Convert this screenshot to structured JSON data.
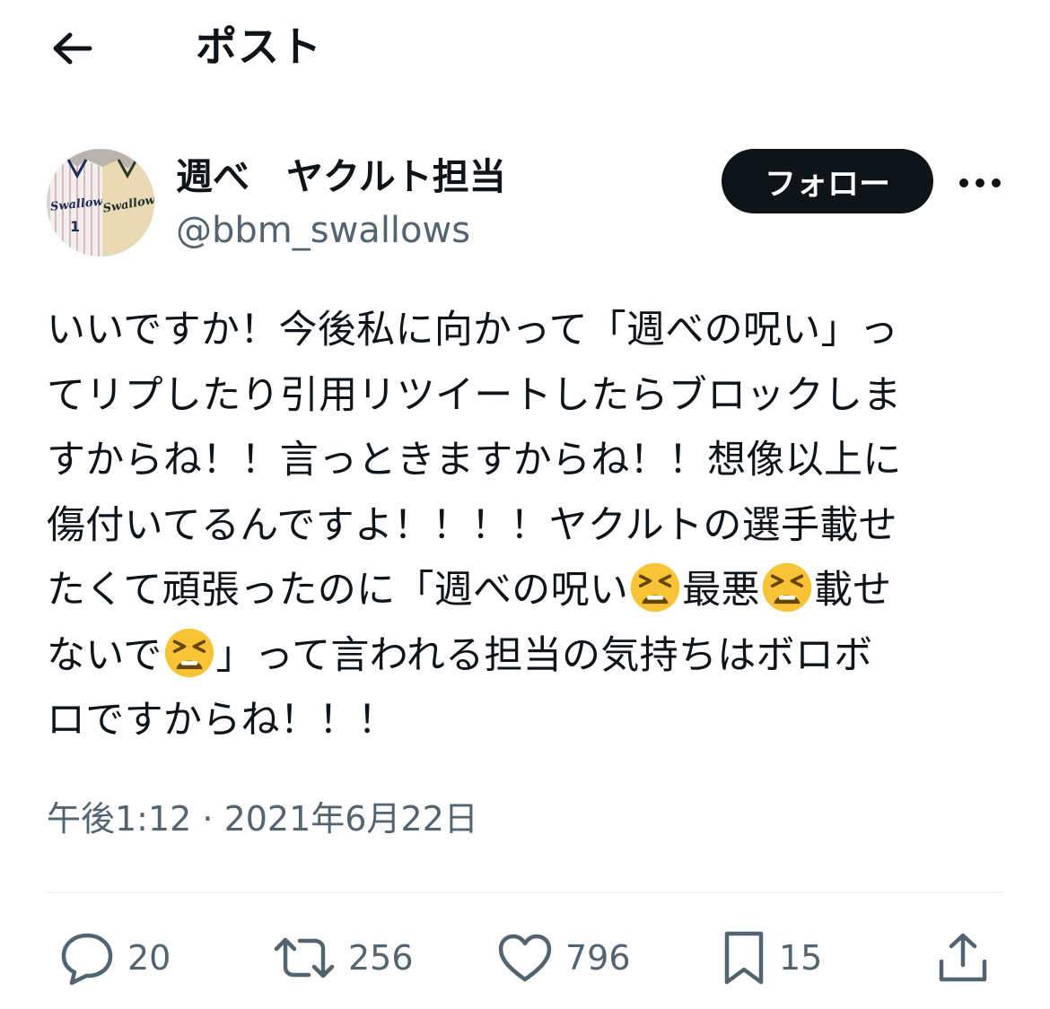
{
  "header": {
    "title": "ポスト"
  },
  "author": {
    "display_name": "週べ　ヤクルト担当",
    "handle": "@bbm_swallows",
    "avatar_jersey_text": [
      "Swallows",
      "Swallows"
    ],
    "avatar_jersey_number": "1"
  },
  "follow_button": {
    "label": "フォロー"
  },
  "tweet": {
    "lines": [
      [
        {
          "text": "いいですか！今後私に向かって「週べの呪い」っ"
        }
      ],
      [
        {
          "text": "てリプしたり引用リツイートしたらブロックしま"
        }
      ],
      [
        {
          "text": "すからね！！言っときますからね！！想像以上に"
        }
      ],
      [
        {
          "text": "傷付いてるんですよ！！！！ヤクルトの選手載せ"
        }
      ],
      [
        {
          "text": "たくて頑張ったのに「週べの呪い"
        },
        {
          "emoji": "tired-face"
        },
        {
          "text": "最悪"
        },
        {
          "emoji": "tired-face"
        },
        {
          "text": "載せ"
        }
      ],
      [
        {
          "text": "ないで"
        },
        {
          "emoji": "tired-face"
        },
        {
          "text": "」って言われる担当の気持ちはボロボ"
        }
      ],
      [
        {
          "text": "ロですからね！！！"
        }
      ]
    ]
  },
  "timestamp": "午後1:12 · 2021年6月22日",
  "actions": {
    "reply": {
      "icon": "reply-icon",
      "count": "20"
    },
    "repost": {
      "icon": "repost-icon",
      "count": "256"
    },
    "like": {
      "icon": "heart-icon",
      "count": "796"
    },
    "bookmark": {
      "icon": "bookmark-icon",
      "count": "15"
    },
    "share": {
      "icon": "share-icon"
    }
  },
  "colors": {
    "text": "#0f1419",
    "secondary": "#536471",
    "divider": "#eff3f4",
    "button_bg": "#0f1419",
    "emoji_face": "#f8c436"
  }
}
